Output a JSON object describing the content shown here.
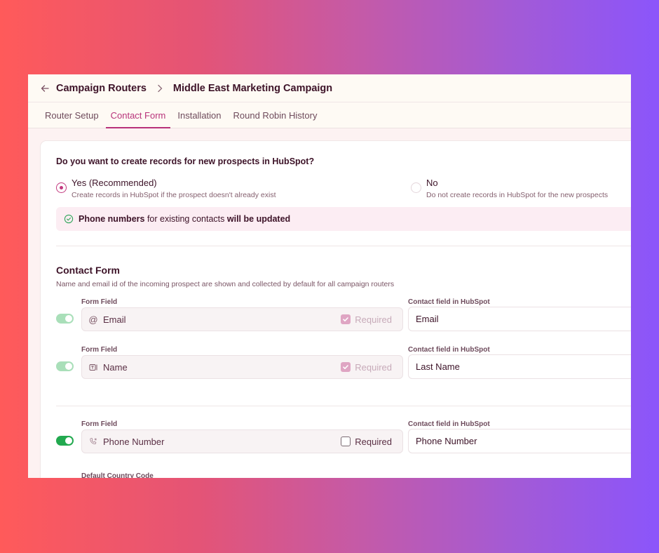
{
  "breadcrumb": {
    "back_icon": "arrow-left-icon",
    "parent": "Campaign Routers",
    "separator_icon": "chevron-right-icon",
    "current": "Middle East Marketing Campaign"
  },
  "tabs": [
    {
      "label": "Router Setup",
      "active": false
    },
    {
      "label": "Contact Form",
      "active": true
    },
    {
      "label": "Installation",
      "active": false
    },
    {
      "label": "Round Robin History",
      "active": false
    }
  ],
  "create_records": {
    "question": "Do you want to create records for new prospects in HubSpot?",
    "options": [
      {
        "title": "Yes (Recommended)",
        "desc": "Create records in HubSpot if the prospect doesn't already exist",
        "selected": true
      },
      {
        "title": "No",
        "desc": "Do not create records in HubSpot for the new prospects",
        "selected": false
      }
    ],
    "notice": {
      "icon": "check-circle-icon",
      "bold1": "Phone numbers",
      "mid": " for existing contacts ",
      "bold2": "will be updated"
    }
  },
  "contact_form": {
    "title": "Contact Form",
    "desc": "Name and email id of the incoming prospect are shown and collected by default for all campaign routers",
    "form_field_label": "Form Field",
    "hub_field_label": "Contact field in HubSpot",
    "required_label": "Required",
    "fields": [
      {
        "name": "Email",
        "icon": "at-sign-icon",
        "enabled": true,
        "locked": true,
        "required": true,
        "hubspot_field": "Email"
      },
      {
        "name": "Name",
        "icon": "text-field-icon",
        "enabled": true,
        "locked": true,
        "required": true,
        "hubspot_field": "Last Name"
      },
      {
        "name": "Phone Number",
        "icon": "phone-icon",
        "enabled": true,
        "locked": false,
        "required": false,
        "hubspot_field": "Phone Number"
      }
    ],
    "default_country_code_label": "Default Country Code"
  },
  "colors": {
    "accent": "#b8337a",
    "toggle_on": "#22a94f",
    "toggle_locked": "#a9dfb9",
    "notice_bg": "#fcedf3"
  }
}
